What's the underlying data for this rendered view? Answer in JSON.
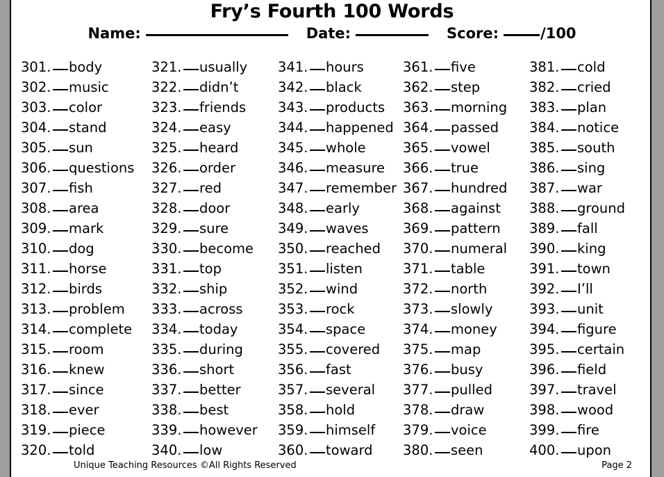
{
  "header": {
    "title": "Fry’s Fourth 100 Words",
    "name_label": "Name:",
    "date_label": "Date:",
    "score_label": "Score:",
    "score_suffix": "/100"
  },
  "footer": {
    "copyright": "Unique Teaching Resources ©All Rights Reserved",
    "page": "Page 2"
  },
  "colors": {
    "ink": "#000000",
    "page": "#ffffff",
    "backdrop": "#9e9e9e"
  },
  "word_list": {
    "range_start": 301,
    "range_end": 400,
    "total": 100,
    "columns": [
      {
        "index": 0,
        "items": [
          {
            "number": "301.",
            "word": "body"
          },
          {
            "number": "302.",
            "word": "music"
          },
          {
            "number": "303.",
            "word": "color"
          },
          {
            "number": "304.",
            "word": "stand"
          },
          {
            "number": "305.",
            "word": "sun"
          },
          {
            "number": "306.",
            "word": "questions"
          },
          {
            "number": "307.",
            "word": "fish"
          },
          {
            "number": "308.",
            "word": "area"
          },
          {
            "number": "309.",
            "word": "mark"
          },
          {
            "number": "310.",
            "word": "dog"
          },
          {
            "number": "311.",
            "word": "horse"
          },
          {
            "number": "312.",
            "word": "birds"
          },
          {
            "number": "313.",
            "word": "problem"
          },
          {
            "number": "314.",
            "word": "complete"
          },
          {
            "number": "315.",
            "word": "room"
          },
          {
            "number": "316.",
            "word": "knew"
          },
          {
            "number": "317.",
            "word": "since"
          },
          {
            "number": "318.",
            "word": "ever"
          },
          {
            "number": "319.",
            "word": "piece"
          },
          {
            "number": "320.",
            "word": "told"
          }
        ]
      },
      {
        "index": 1,
        "items": [
          {
            "number": "321.",
            "word": "usually"
          },
          {
            "number": "322.",
            "word": "didn’t"
          },
          {
            "number": "323.",
            "word": "friends"
          },
          {
            "number": "324.",
            "word": "easy"
          },
          {
            "number": "325.",
            "word": "heard"
          },
          {
            "number": "326.",
            "word": "order"
          },
          {
            "number": "327.",
            "word": "red"
          },
          {
            "number": "328.",
            "word": "door"
          },
          {
            "number": "329.",
            "word": "sure"
          },
          {
            "number": "330.",
            "word": "become"
          },
          {
            "number": "331.",
            "word": "top"
          },
          {
            "number": "332.",
            "word": "ship"
          },
          {
            "number": "333.",
            "word": "across"
          },
          {
            "number": "334.",
            "word": "today"
          },
          {
            "number": "335.",
            "word": "during"
          },
          {
            "number": "336.",
            "word": "short"
          },
          {
            "number": "337.",
            "word": "better"
          },
          {
            "number": "338.",
            "word": "best"
          },
          {
            "number": "339.",
            "word": "however"
          },
          {
            "number": "340.",
            "word": "low"
          }
        ]
      },
      {
        "index": 2,
        "items": [
          {
            "number": "341.",
            "word": "hours"
          },
          {
            "number": "342.",
            "word": "black"
          },
          {
            "number": "343.",
            "word": "products"
          },
          {
            "number": "344.",
            "word": "happened"
          },
          {
            "number": "345.",
            "word": "whole"
          },
          {
            "number": "346.",
            "word": "measure"
          },
          {
            "number": "347.",
            "word": "remember"
          },
          {
            "number": "348.",
            "word": "early"
          },
          {
            "number": "349.",
            "word": "waves"
          },
          {
            "number": "350.",
            "word": "reached"
          },
          {
            "number": "351.",
            "word": "listen"
          },
          {
            "number": "352.",
            "word": "wind"
          },
          {
            "number": "353.",
            "word": "rock"
          },
          {
            "number": "354.",
            "word": "space"
          },
          {
            "number": "355.",
            "word": "covered"
          },
          {
            "number": "356.",
            "word": "fast"
          },
          {
            "number": "357.",
            "word": "several"
          },
          {
            "number": "358.",
            "word": "hold"
          },
          {
            "number": "359.",
            "word": "himself"
          },
          {
            "number": "360.",
            "word": "toward"
          }
        ]
      },
      {
        "index": 3,
        "items": [
          {
            "number": "361.",
            "word": "five"
          },
          {
            "number": "362.",
            "word": "step"
          },
          {
            "number": "363.",
            "word": "morning"
          },
          {
            "number": "364.",
            "word": "passed"
          },
          {
            "number": "365.",
            "word": "vowel"
          },
          {
            "number": "366.",
            "word": "true"
          },
          {
            "number": "367.",
            "word": "hundred"
          },
          {
            "number": "368.",
            "word": "against"
          },
          {
            "number": "369.",
            "word": "pattern"
          },
          {
            "number": "370.",
            "word": "numeral"
          },
          {
            "number": "371.",
            "word": "table"
          },
          {
            "number": "372.",
            "word": "north"
          },
          {
            "number": "373.",
            "word": "slowly"
          },
          {
            "number": "374.",
            "word": "money"
          },
          {
            "number": "375.",
            "word": "map"
          },
          {
            "number": "376.",
            "word": "busy"
          },
          {
            "number": "377.",
            "word": "pulled"
          },
          {
            "number": "378.",
            "word": "draw"
          },
          {
            "number": "379.",
            "word": "voice"
          },
          {
            "number": "380.",
            "word": "seen"
          }
        ]
      },
      {
        "index": 4,
        "items": [
          {
            "number": "381.",
            "word": "cold"
          },
          {
            "number": "382.",
            "word": "cried"
          },
          {
            "number": "383.",
            "word": "plan"
          },
          {
            "number": "384.",
            "word": "notice"
          },
          {
            "number": "385.",
            "word": "south"
          },
          {
            "number": "386.",
            "word": "sing"
          },
          {
            "number": "387.",
            "word": "war"
          },
          {
            "number": "388.",
            "word": "ground"
          },
          {
            "number": "389.",
            "word": "fall"
          },
          {
            "number": "390.",
            "word": "king"
          },
          {
            "number": "391.",
            "word": "town"
          },
          {
            "number": "392.",
            "word": "I’ll"
          },
          {
            "number": "393.",
            "word": "unit"
          },
          {
            "number": "394.",
            "word": "figure"
          },
          {
            "number": "395.",
            "word": "certain"
          },
          {
            "number": "396.",
            "word": "field"
          },
          {
            "number": "397.",
            "word": "travel"
          },
          {
            "number": "398.",
            "word": "wood"
          },
          {
            "number": "399.",
            "word": "fire"
          },
          {
            "number": "400.",
            "word": "upon"
          }
        ]
      }
    ]
  }
}
